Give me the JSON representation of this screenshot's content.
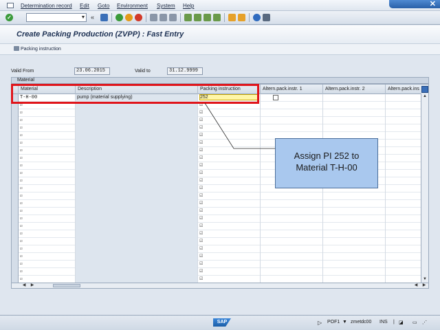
{
  "menu": {
    "items": [
      "Determination record",
      "Edit",
      "Goto",
      "Environment",
      "System",
      "Help"
    ]
  },
  "toolbar": {
    "command_value": "",
    "back_symbol": "«"
  },
  "title": "Create Packing Production (ZVPP) : Fast Entry",
  "app_toolbar": {
    "packing_instruction_button": "Packing instruction"
  },
  "validity": {
    "valid_from_label": "Valid From",
    "valid_from": "23.06.2015",
    "valid_to_label": "Valid to",
    "valid_to": "31.12.9999"
  },
  "table": {
    "caption": "Material",
    "headers": [
      "Material",
      "Description",
      "Packing instruction",
      "Altern.pack.instr. 1",
      "Altern.pack.instr. 2",
      "Altern.pack.ins"
    ],
    "first_row": {
      "material": "T-H-00",
      "description": "pump  (material supplying)",
      "packing_instruction": "252"
    },
    "checkbox_symbol": "☑"
  },
  "callout": {
    "line1": "Assign PI 252 to",
    "line2": "Material T-H-00"
  },
  "status": {
    "system": "POF1",
    "server": "zmetdc00",
    "mode": "INS",
    "logo": "SAP"
  },
  "colors": {
    "highlight_frame": "#e0141a",
    "callout_bg": "#a9c8ee",
    "input_highlight": "#fff6a8"
  }
}
